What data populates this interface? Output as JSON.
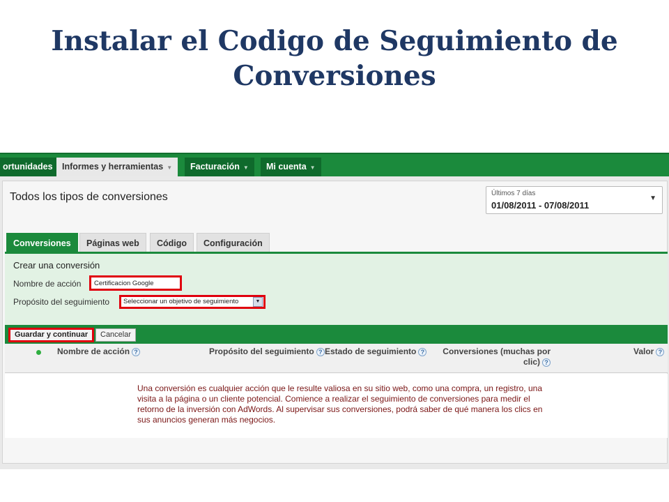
{
  "slide": {
    "title_line1": "Instalar el Codigo de Seguimiento de",
    "title_line2": "Conversiones"
  },
  "topnav": {
    "tabs": [
      {
        "label": "ortunidades",
        "active": false
      },
      {
        "label": "Informes y herramientas",
        "active": true
      },
      {
        "label": "Facturación",
        "active": false
      },
      {
        "label": "Mi cuenta",
        "active": false
      }
    ],
    "caret": "▼"
  },
  "page": {
    "heading": "Todos los tipos de conversiones"
  },
  "date_range": {
    "label": "Últimos 7 días",
    "value": "01/08/2011 - 07/08/2011",
    "caret": "▼"
  },
  "subtabs": [
    {
      "label": "Conversiones",
      "active": true
    },
    {
      "label": "Páginas web",
      "active": false
    },
    {
      "label": "Código",
      "active": false
    },
    {
      "label": "Configuración",
      "active": false
    }
  ],
  "form": {
    "title": "Crear una conversión",
    "name_label": "Nombre de acción",
    "name_value": "Certificacion Google",
    "purpose_label": "Propósito del seguimiento",
    "purpose_value": "Seleccionar un objetivo de seguimiento",
    "purpose_arrow": "▼"
  },
  "actions": {
    "save_label": "Guardar y continuar",
    "cancel_label": "Cancelar"
  },
  "table": {
    "headers": {
      "name": "Nombre de acción",
      "purpose": "Propósito del seguimiento",
      "status": "Estado de seguimiento",
      "conversions_line1": "Conversiones (muchas por",
      "conversions_line2": "clic)",
      "value": "Valor"
    },
    "help_glyph": "?",
    "status_dot_color": "#2eae3f"
  },
  "intro": {
    "text": "Una conversión es cualquier acción que le resulte valiosa en su sitio web, como una compra, un registro, una visita a la página o un cliente potencial. Comience a realizar el seguimiento de conversiones para medir el retorno de la inversión con AdWords. Al supervisar sus conversiones, podrá saber de qué manera los clics en sus anuncios generan más negocios."
  },
  "colors": {
    "title": "#1f3864",
    "adwords_green": "#1b8a3c",
    "highlight_red": "#e0000e",
    "intro_text": "#7a1616"
  }
}
